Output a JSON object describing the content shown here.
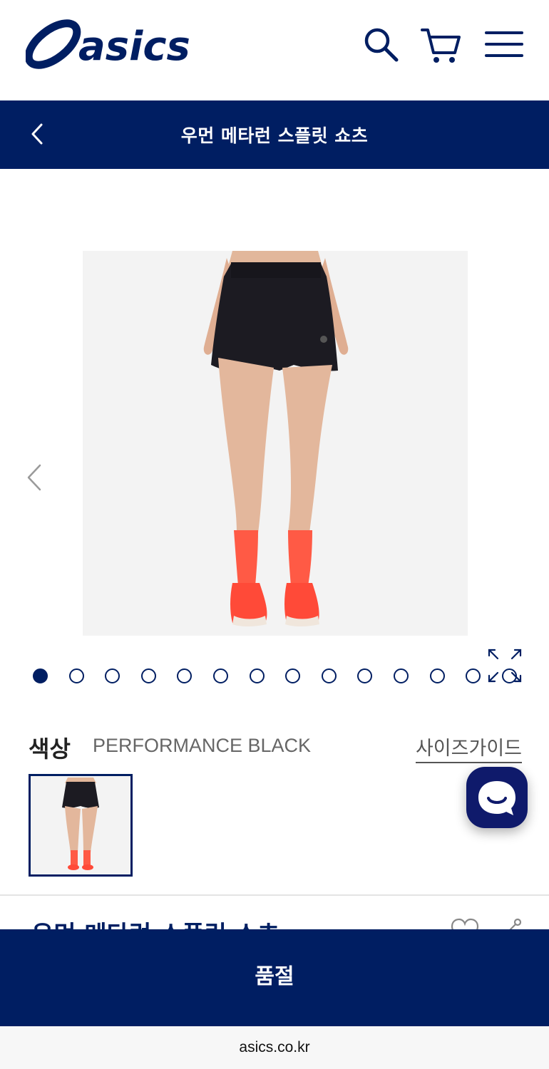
{
  "header": {
    "logo_text": "asics",
    "icons": [
      "search-icon",
      "cart-icon",
      "menu-icon"
    ]
  },
  "titlebar": {
    "title": "우먼 메타런 스플릿 쇼츠",
    "back_icon": "chevron-left-icon"
  },
  "gallery": {
    "image_count": 14,
    "active_index": 0,
    "prev_icon": "chevron-left-icon",
    "zoom_icon": "expand-icon"
  },
  "color": {
    "label": "색상",
    "value": "PERFORMANCE BLACK",
    "size_guide": "사이즈가이드"
  },
  "product": {
    "name": "우먼 메타런 스플릿 쇼츠"
  },
  "cta": {
    "label": "품절"
  },
  "browser": {
    "url": "asics.co.kr"
  },
  "colors": {
    "brand": "#001e62",
    "chat_button": "#0f1a6b",
    "image_bg": "#f3f3f3",
    "sock_orange": "#ff5a45"
  }
}
